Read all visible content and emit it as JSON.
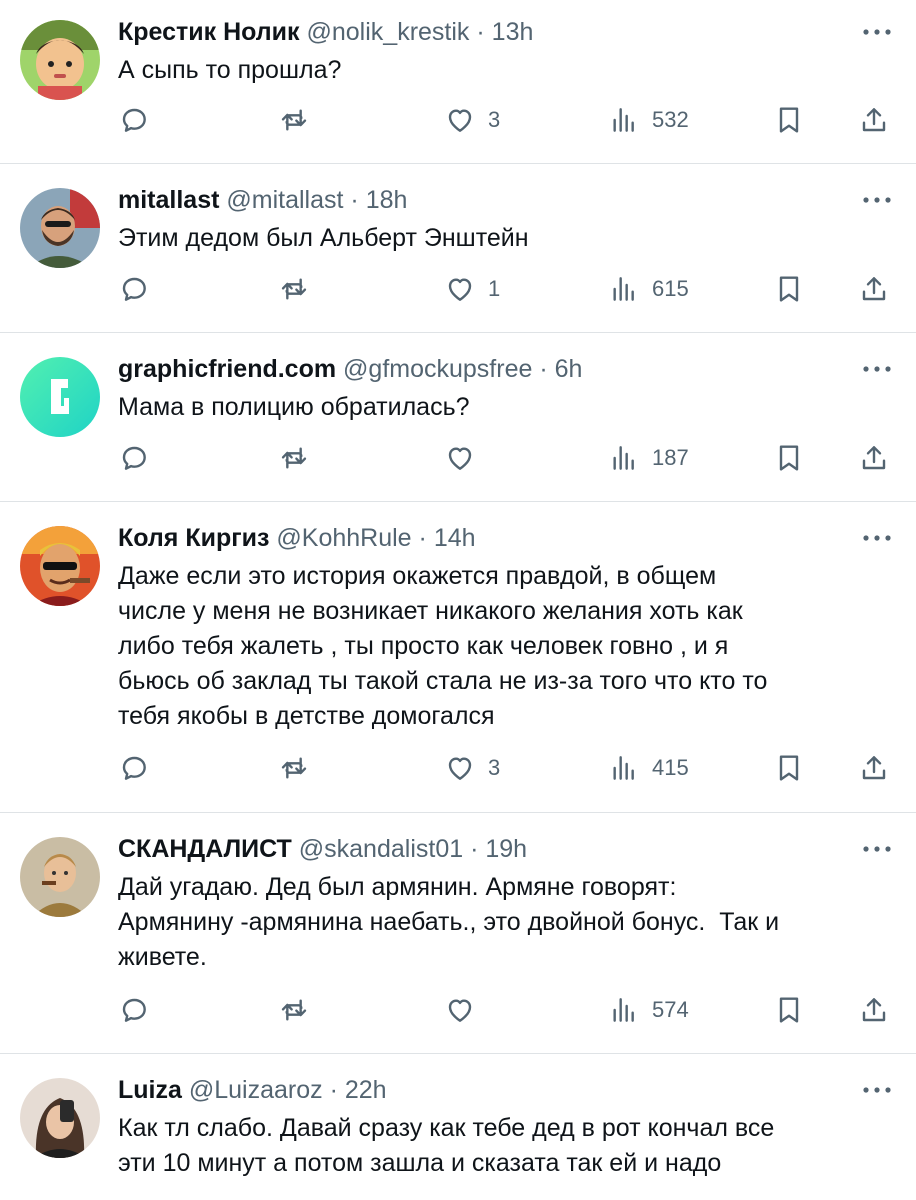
{
  "colors": {
    "text": "#0f1419",
    "secondary": "#536471",
    "divider": "#dfe3e6"
  },
  "tweets": [
    {
      "name": "Крестик Нолик",
      "handle": "@nolik_krestik",
      "sep": "·",
      "time": "13h",
      "lines": [
        "А сыпь то прошла?"
      ],
      "likes": "3",
      "views": "532"
    },
    {
      "name": "mitallast",
      "handle": "@mitallast",
      "sep": "·",
      "time": "18h",
      "lines": [
        "Этим дедом был Альберт Энштейн"
      ],
      "likes": "1",
      "views": "615"
    },
    {
      "name": "graphicfriend.com",
      "handle": "@gfmockupsfree",
      "sep": "·",
      "time": "6h",
      "lines": [
        "Мама в полицию обратилась?"
      ],
      "likes": "",
      "views": "187"
    },
    {
      "name": "Коля Киргиз",
      "handle": "@KohhRule",
      "sep": "·",
      "time": "14h",
      "lines": [
        "Даже если это история окажется правдой, в общем",
        "числе у меня не возникает никакого желания хоть как",
        "либо тебя жалеть , ты просто как человек говно , и я",
        "бьюсь об заклад ты такой стала не из-за того что кто то",
        "тебя якобы в детстве домогался"
      ],
      "likes": "3",
      "views": "415"
    },
    {
      "name": "СКАНДАЛИСТ",
      "handle": "@skandalist01",
      "sep": "·",
      "time": "19h",
      "lines": [
        "Дай угадаю. Дед был армянин. Армяне говорят:",
        "Армянину -армянина наебать., это двойной бонус.  Так и",
        "живете."
      ],
      "likes": "",
      "views": "574"
    },
    {
      "name": "Luiza",
      "handle": "@Luizaaroz",
      "sep": "·",
      "time": "22h",
      "lines": [
        "Как тл слабо. Давай сразу как тебе дед в рот кончал все",
        "эти 10 минут а потом зашла и сказата так ей и надо"
      ]
    }
  ]
}
